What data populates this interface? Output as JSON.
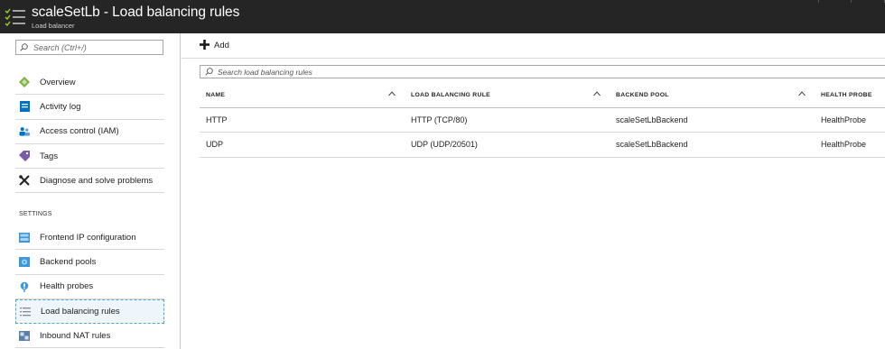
{
  "header": {
    "title": "scaleSetLb - Load balancing rules",
    "subtitle": "Load balancer"
  },
  "sidebar": {
    "search_placeholder": "Search (Ctrl+/)",
    "items": [
      {
        "label": "Overview",
        "icon": "overview-diamond-icon"
      },
      {
        "label": "Activity log",
        "icon": "activity-log-icon"
      },
      {
        "label": "Access control (IAM)",
        "icon": "people-icon"
      },
      {
        "label": "Tags",
        "icon": "tag-icon"
      },
      {
        "label": "Diagnose and solve problems",
        "icon": "wrench-icon"
      }
    ],
    "settings_label": "SETTINGS",
    "settings_items": [
      {
        "label": "Frontend IP configuration",
        "icon": "frontend-ip-icon"
      },
      {
        "label": "Backend pools",
        "icon": "backend-pool-icon"
      },
      {
        "label": "Health probes",
        "icon": "health-probe-icon"
      },
      {
        "label": "Load balancing rules",
        "icon": "list-icon",
        "selected": true
      },
      {
        "label": "Inbound NAT rules",
        "icon": "nat-rules-icon"
      }
    ]
  },
  "toolbar": {
    "add_label": "Add"
  },
  "filter": {
    "placeholder": "Search load balancing rules"
  },
  "table": {
    "columns": [
      "NAME",
      "LOAD BALANCING RULE",
      "BACKEND POOL",
      "HEALTH PROBE"
    ],
    "rows": [
      [
        "HTTP",
        "HTTP (TCP/80)",
        "scaleSetLbBackend",
        "HealthProbe"
      ],
      [
        "UDP",
        "UDP (UDP/20501)",
        "scaleSetLbBackend",
        "HealthProbe"
      ]
    ]
  },
  "colors": {
    "header_bg": "#252525",
    "accent": "#0072c6",
    "selection_border": "#4fa3d8"
  }
}
